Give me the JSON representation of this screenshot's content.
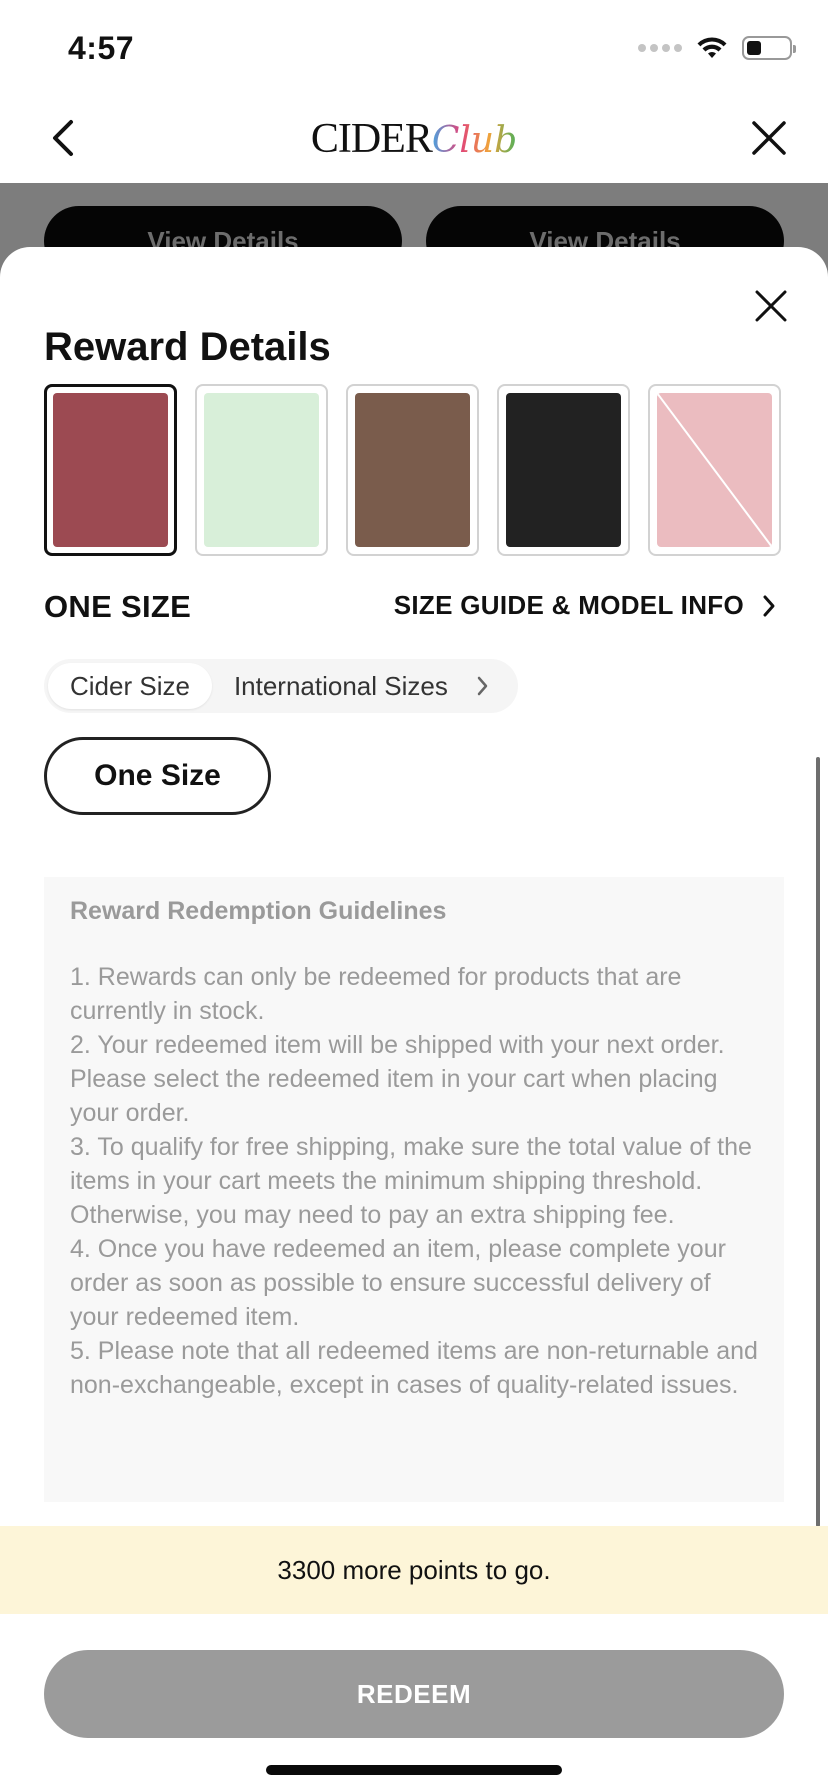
{
  "status_bar": {
    "time": "4:57"
  },
  "nav": {
    "brand": "CIDER",
    "brand_suffix": "Club"
  },
  "background": {
    "left_button": "View Details",
    "right_button": "View Details"
  },
  "sheet": {
    "title": "Reward Details",
    "swatches": [
      {
        "color": "#9c4a52",
        "selected": true,
        "unavailable": false
      },
      {
        "color": "#d8efd9",
        "selected": false,
        "unavailable": false
      },
      {
        "color": "#7a5c4c",
        "selected": false,
        "unavailable": false
      },
      {
        "color": "#222222",
        "selected": false,
        "unavailable": false
      },
      {
        "color": "#ebbcc0",
        "selected": false,
        "unavailable": true
      }
    ],
    "size_label": "ONE SIZE",
    "size_guide_link": "SIZE GUIDE & MODEL INFO",
    "size_tabs": [
      "Cider Size",
      "International Sizes"
    ],
    "size_option": "One Size",
    "guidelines": {
      "title": "Reward Redemption Guidelines",
      "items": [
        "1. Rewards can only be redeemed for products that are currently in stock.",
        "2. Your redeemed item will be shipped with your next order. Please select the redeemed item in your cart when placing your order.",
        "3. To qualify for free shipping, make sure the total value of the items in your cart meets the minimum shipping threshold. Otherwise, you may need to pay an extra shipping fee.",
        "4. Once you have redeemed an item, please complete your order as soon as possible to ensure successful delivery of your redeemed item.",
        "5. Please note that all redeemed items are non-returnable and non-exchangeable, except in cases of quality-related issues."
      ]
    },
    "points_message": "3300 more points to go.",
    "redeem_label": "REDEEM"
  },
  "icons": {
    "back": "chevron-left-icon",
    "close": "close-icon",
    "size_guide_chevron": "chevron-right-icon"
  },
  "colors": {
    "points_banner": "#fdf5d8",
    "redeem_disabled": "#9b9b9b",
    "guidelines_bg": "#f8f8f8"
  }
}
